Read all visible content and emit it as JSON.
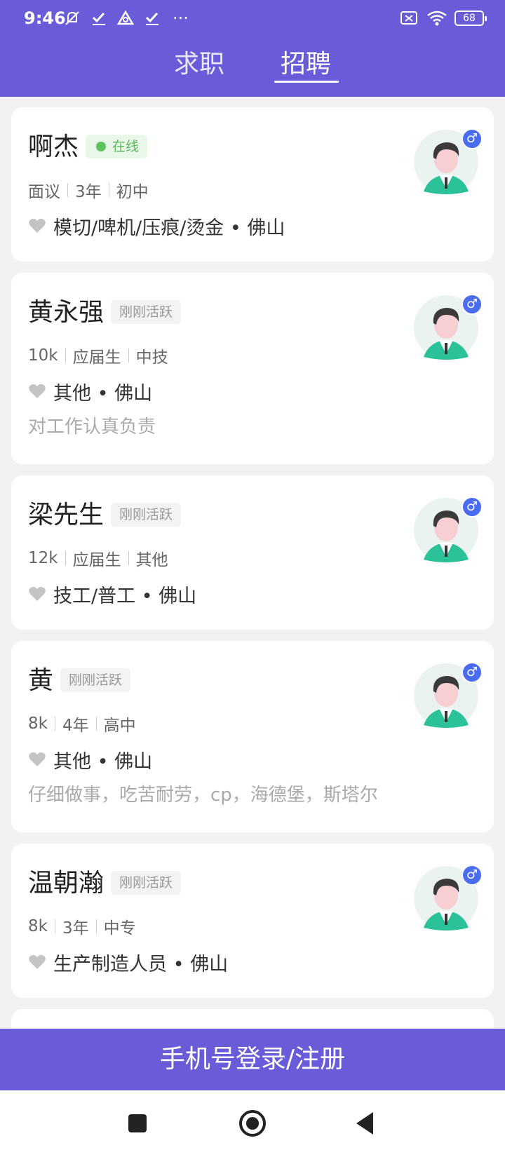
{
  "status_bar": {
    "time": "9:46",
    "battery": "68",
    "dots": "···"
  },
  "tabs": [
    {
      "label": "求职",
      "active": false
    },
    {
      "label": "招聘",
      "active": true
    }
  ],
  "candidates": [
    {
      "name": "啊杰",
      "badge": "在线",
      "badge_type": "online",
      "meta": [
        "面议",
        "3年",
        "初中"
      ],
      "skills": "模切/啤机/压痕/烫金 • 佛山",
      "intro": ""
    },
    {
      "name": "黄永强",
      "badge": "刚刚活跃",
      "badge_type": "active",
      "meta": [
        "10k",
        "应届生",
        "中技"
      ],
      "skills": "其他 • 佛山",
      "intro": "对工作认真负责"
    },
    {
      "name": "梁先生",
      "badge": "刚刚活跃",
      "badge_type": "active",
      "meta": [
        "12k",
        "应届生",
        "其他"
      ],
      "skills": "技工/普工 • 佛山",
      "intro": ""
    },
    {
      "name": "黄",
      "badge": "刚刚活跃",
      "badge_type": "active",
      "meta": [
        "8k",
        "4年",
        "高中"
      ],
      "skills": "其他 • 佛山",
      "intro": "仔细做事，吃苦耐劳，cp，海德堡，斯塔尔"
    },
    {
      "name": "温朝瀚",
      "badge": "刚刚活跃",
      "badge_type": "active",
      "meta": [
        "8k",
        "3年",
        "中专"
      ],
      "skills": "生产制造人员 • 佛山",
      "intro": ""
    }
  ],
  "login_button": "手机号登录/注册",
  "colors": {
    "primary": "#6a5cd8",
    "online_green": "#5cc45c",
    "gender_blue": "#4a6cf0"
  },
  "icons": [
    "wifi-icon",
    "battery-icon",
    "heart-icon",
    "avatar-icon",
    "male-icon",
    "nav-square-icon",
    "nav-circle-icon",
    "nav-back-icon"
  ]
}
